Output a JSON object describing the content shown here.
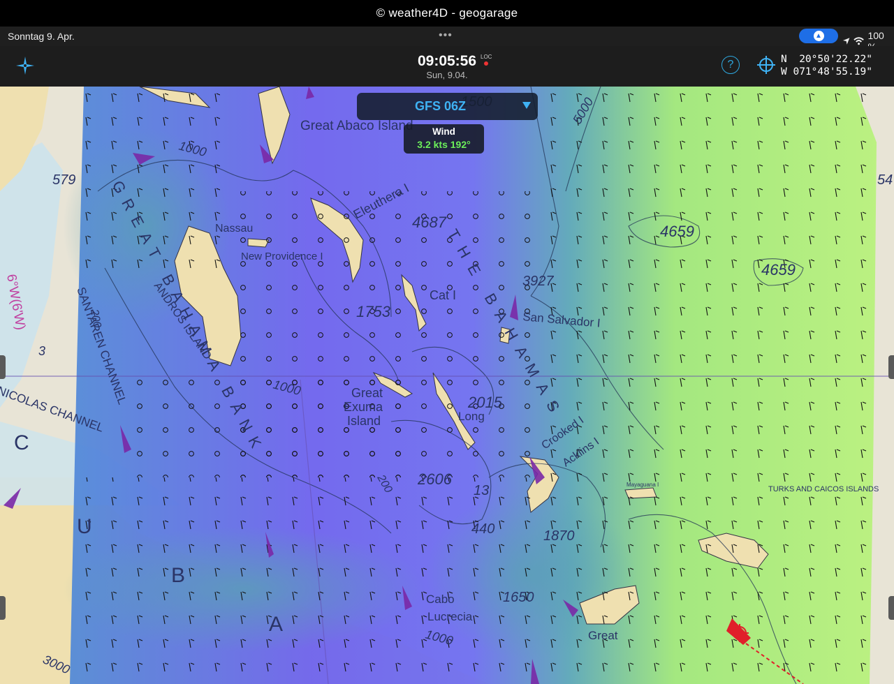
{
  "caption": "© weather4D - geogarage",
  "status_bar": {
    "date": "Sonntag 9. Apr.",
    "battery": "100 %"
  },
  "header": {
    "time": "09:05:56",
    "loc_label": "LOC",
    "date": "Sun, 9.04.",
    "coords_n": "N  20°50'22.22\"",
    "coords_w": "W 071°48'55.19\""
  },
  "model_selector": {
    "label": "GFS 06Z"
  },
  "wind_info": {
    "title": "Wind",
    "value": "3.2 kts 192°"
  },
  "map_labels": {
    "great_abaco": "Great Abaco Island",
    "eleuthera": "Eleuthera I",
    "nassau": "Nassau",
    "new_providence": "New Providence I",
    "andros": "ANDROS ISLAND",
    "great_bahama_bank": "GREAT BAHAMA BANK",
    "cat": "Cat I",
    "the_bahamas": "THE BAHAMAS",
    "san_salvador": "San Salvador I",
    "great_exuma_1": "Great",
    "great_exuma_2": "Exuma",
    "great_exuma_3": "Island",
    "long": "Long",
    "crooked": "Crooked I",
    "acklins": "Acklins I",
    "mayaguana": "Mayaguana I",
    "turks_caicos": "TURKS AND CAICOS ISLANDS",
    "cabo_lucrecia_1": "Cabo",
    "cabo_lucrecia_2": "Lucrecia",
    "great_inagua": "Great",
    "santaren": "SANTAREN CHANNEL",
    "nicolas": "NICOLAS CHANNEL",
    "cuba_c": "C",
    "cuba_u": "U",
    "cuba_b": "B",
    "cuba_a": "A",
    "depth_4687": "4687",
    "depth_1753": "1753",
    "depth_2015": "2015",
    "depth_2606": "2606",
    "depth_4659a": "4659",
    "depth_4659b": "4659",
    "depth_3927": "3927",
    "depth_5000": "5000",
    "depth_1500": "1500",
    "depth_1000a": "1000",
    "depth_1000b": "1000",
    "depth_1000c": "1000",
    "depth_1870": "1870",
    "depth_1650": "1650",
    "depth_579": "579",
    "depth_200a": "200",
    "depth_200b": "200",
    "depth_3000": "3000",
    "depth_3": "3",
    "depth_440": "440",
    "depth_13": "13",
    "depth_54": "54",
    "mag_var": "6°W(6'W)"
  },
  "colors": {
    "chart_bg": "#e8e4d6",
    "land": "#efe0b0",
    "water_shallow": "#cfe3ea",
    "wind_weak": "#6b5cf0",
    "wind_mid": "#4aa8b8",
    "wind_strong": "#a8f070",
    "accent": "#3fb2f4",
    "boat": "#e0202a"
  }
}
